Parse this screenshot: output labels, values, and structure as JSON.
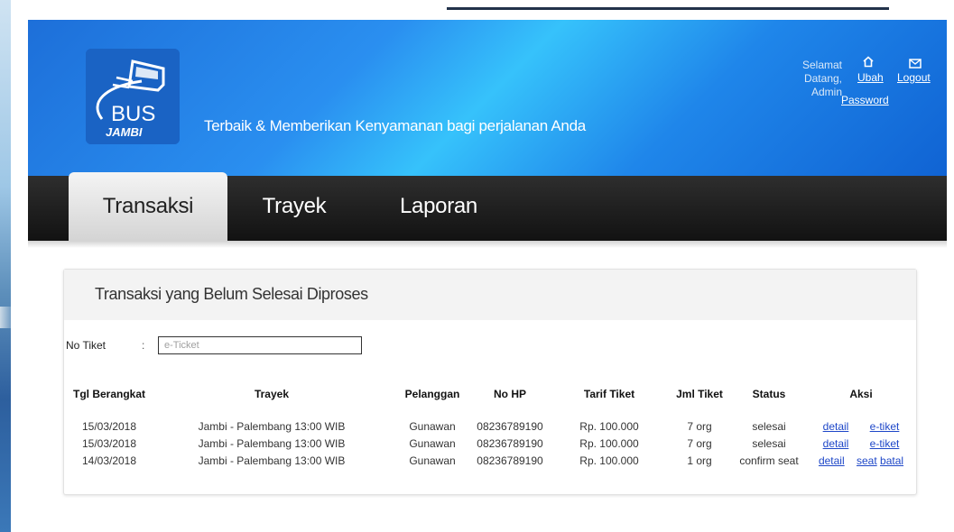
{
  "header": {
    "logo_text_top": "BUS",
    "logo_text_bottom": "JAMBI",
    "tagline": "Terbaik & Memberikan Kenyamanan bagi perjalanan Anda",
    "welcome": "Selamat Datang, Admin",
    "change_password_label_1": "Ubah",
    "change_password_label_2": "Password",
    "logout_label": "Logout",
    "home_icon": "home-icon",
    "mail_icon": "mail-icon"
  },
  "nav": {
    "tabs": [
      {
        "label": "Transaksi",
        "active": true
      },
      {
        "label": "Trayek",
        "active": false
      },
      {
        "label": "Laporan",
        "active": false
      }
    ]
  },
  "panel": {
    "title": "Transaksi yang Belum Selesai Diproses",
    "filter": {
      "label": "No Tiket",
      "colon": ":",
      "placeholder": "e-Ticket",
      "value": ""
    },
    "table": {
      "headers": [
        "Tgl Berangkat",
        "Trayek",
        "Pelanggan",
        "No HP",
        "Tarif Tiket",
        "Jml Tiket",
        "Status",
        "Aksi"
      ],
      "rows": [
        {
          "tgl": "15/03/2018",
          "trayek": "Jambi - Palembang 13:00 WIB",
          "pelanggan": "Gunawan",
          "hp": "08236789190",
          "tarif": "Rp. 100.000",
          "jml": "7 org",
          "status": "selesai",
          "aksi": [
            "detail",
            "e-tiket"
          ]
        },
        {
          "tgl": "15/03/2018",
          "trayek": "Jambi - Palembang 13:00 WIB",
          "pelanggan": "Gunawan",
          "hp": "08236789190",
          "tarif": "Rp. 100.000",
          "jml": "7 org",
          "status": "selesai",
          "aksi": [
            "detail",
            "e-tiket"
          ]
        },
        {
          "tgl": "14/03/2018",
          "trayek": "Jambi - Palembang 13:00 WIB",
          "pelanggan": "Gunawan",
          "hp": "08236789190",
          "tarif": "Rp. 100.000",
          "jml": "1 org",
          "status": "confirm seat",
          "aksi": [
            "detail",
            "seat",
            "batal"
          ]
        }
      ]
    }
  },
  "colors": {
    "header_blue": "#2a8ff0",
    "navbar": "#1a1a1a",
    "link": "#1e47c8"
  }
}
